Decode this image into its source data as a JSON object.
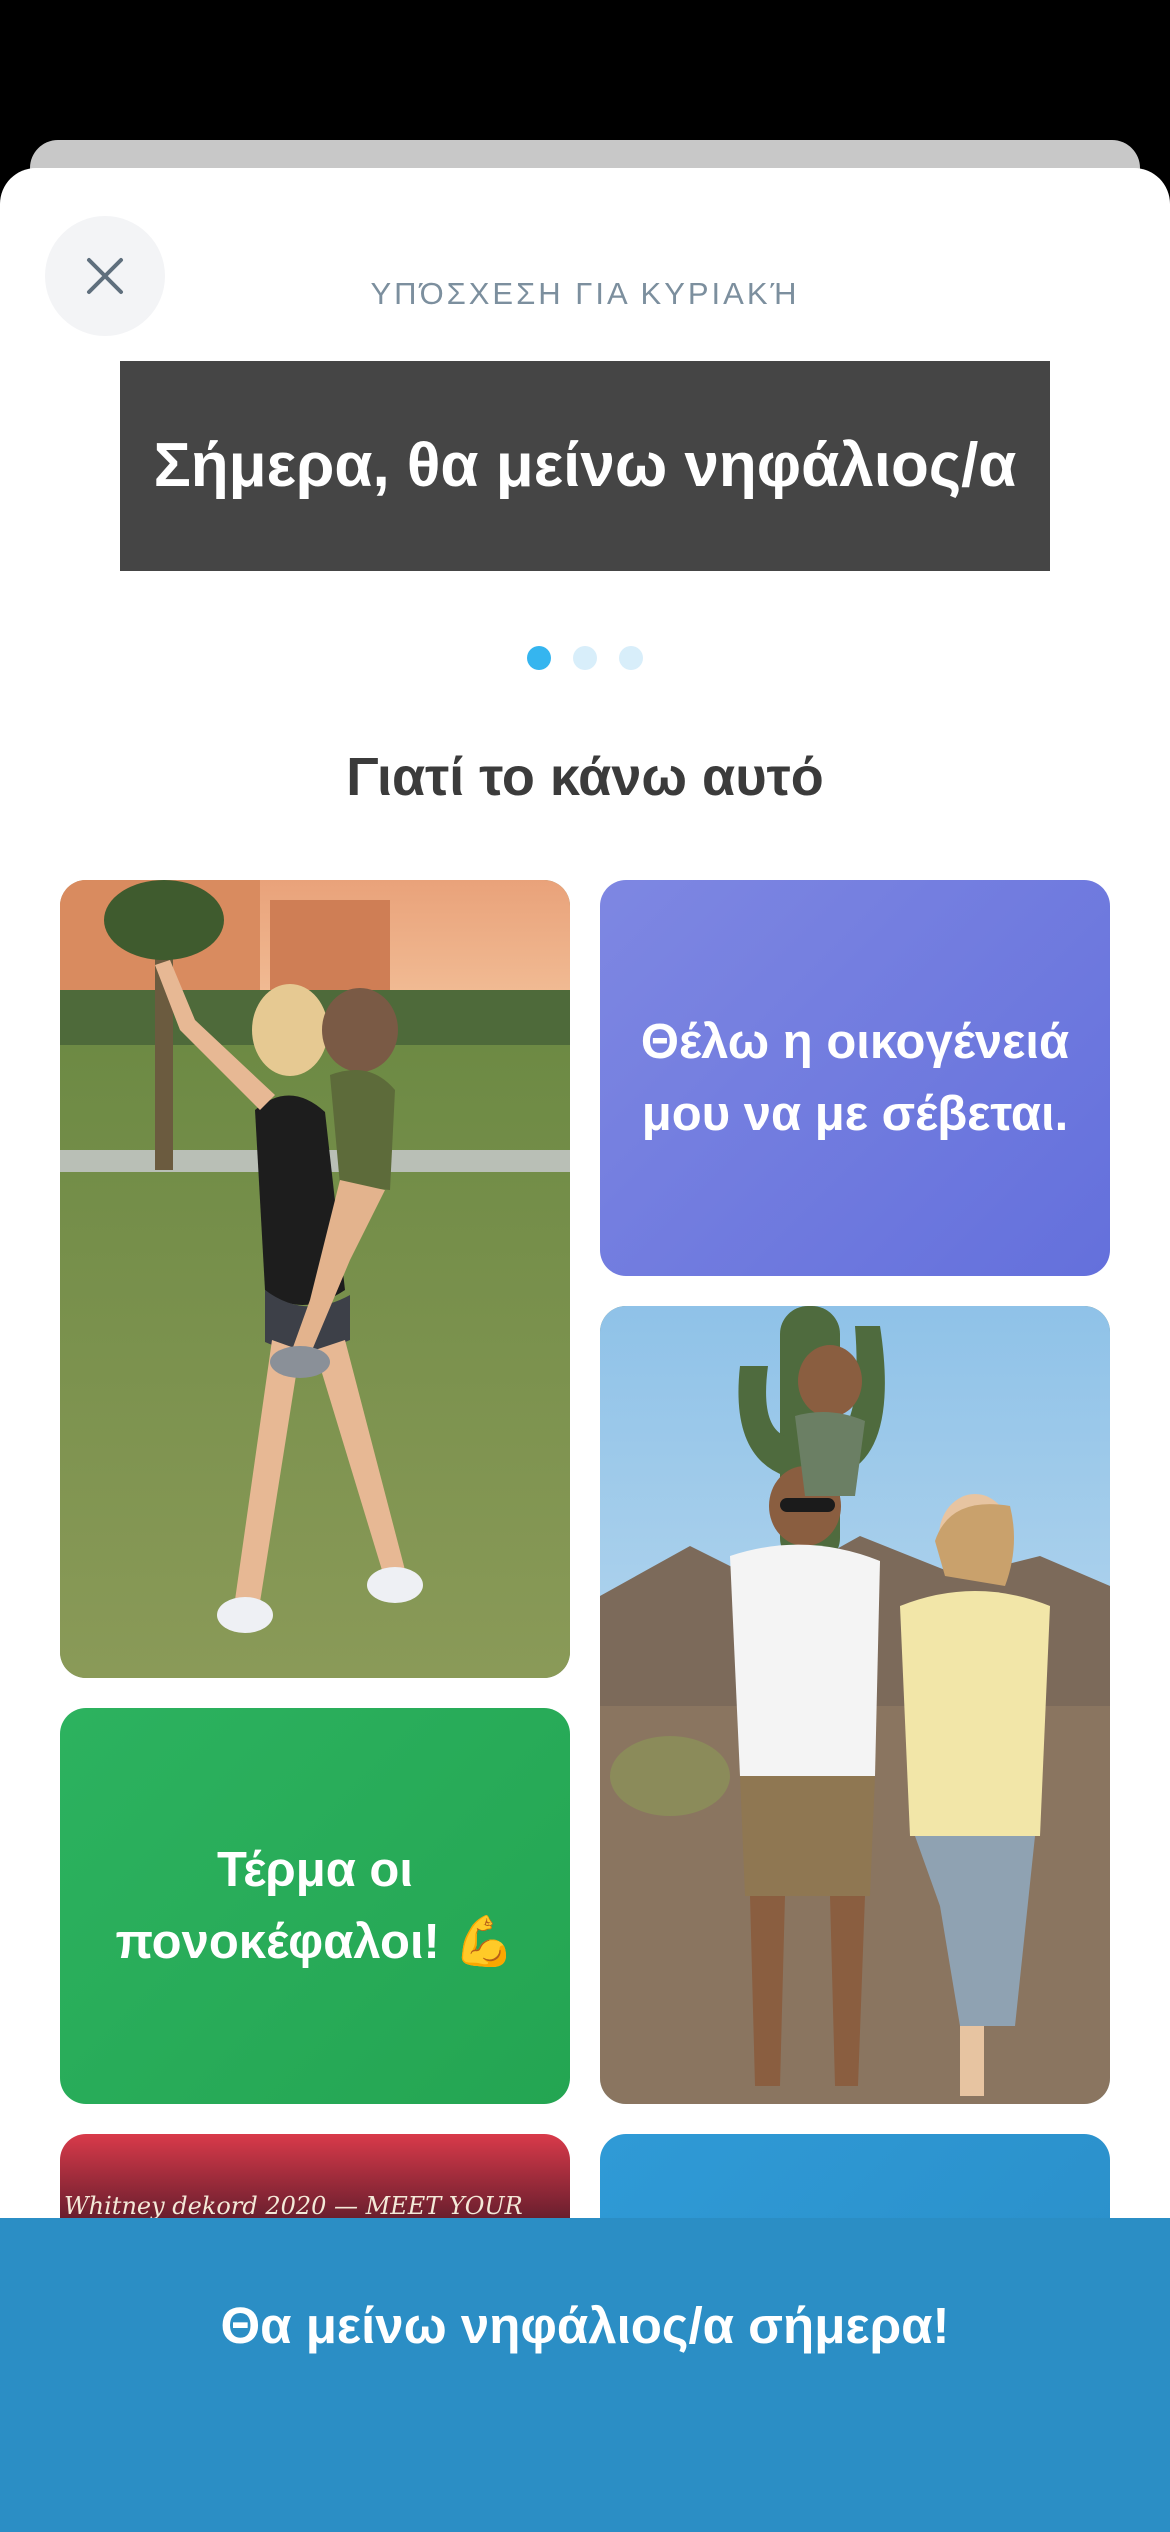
{
  "sheet": {
    "subtitle": "ΥΠΌΣΧΕΣΗ ΓΙΑ ΚΥΡΙΑΚΉ",
    "pledge": "Σήμερα, θα μείνω νηφάλιος/α",
    "pager": {
      "count": 3,
      "active": 1
    },
    "section_title": "Γιατί το κάνω αυτό"
  },
  "cards": {
    "respect_text": "Θέλω η οικογένειά μου να με σέβεται.",
    "hangover_text": "Τέρμα οι πονοκέφαλοι! 💪",
    "neon_sign_text": "Whitney dekord 2020 — MEET YOUR"
  },
  "colors": {
    "accent_blue": "#2b8ec5",
    "purple_card": "#6f76dd",
    "green_card": "#28b05a",
    "active_dot": "#35b5ef",
    "pledge_bg": "#454545"
  },
  "bottom_button": {
    "label": "Θα μείνω νηφάλιος/α σήμερα!"
  },
  "icons": {
    "close": "close-icon"
  }
}
